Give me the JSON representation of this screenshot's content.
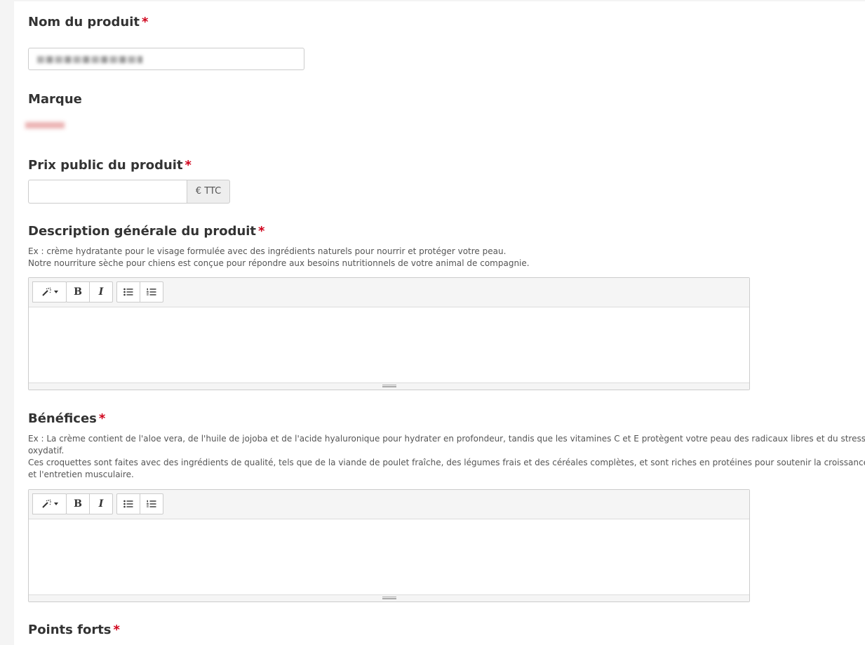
{
  "fields": {
    "product_name": {
      "label": "Nom du produit",
      "required_mark": "*"
    },
    "brand": {
      "label": "Marque"
    },
    "price": {
      "label": "Prix public du produit",
      "required_mark": "*",
      "addon": "€ TTC"
    },
    "description": {
      "label": "Description générale du produit",
      "required_mark": "*",
      "hint_lines": [
        "Ex : crème hydratante pour le visage formulée avec des ingrédients naturels pour nourrir et protéger votre peau.",
        "Notre nourriture sèche pour chiens est conçue pour répondre aux besoins nutritionnels de votre animal de compagnie."
      ]
    },
    "benefits": {
      "label": "Bénéfices",
      "required_mark": "*",
      "hint_lines": [
        "Ex : La crème contient de l'aloe vera, de l'huile de jojoba et de l'acide hyaluronique pour hydrater en profondeur, tandis que les vitamines C et E protègent votre peau des radicaux libres et du stress oxydatif.",
        "Ces croquettes sont faites avec des ingrédients de qualité, tels que de la viande de poulet fraîche, des légumes frais et des céréales complètes, et sont riches en protéines pour soutenir la croissance et l'entretien musculaire."
      ]
    },
    "strengths": {
      "label": "Points forts",
      "required_mark": "*"
    }
  },
  "editor_toolbar": {
    "bold_label": "B",
    "italic_label": "I",
    "icons": [
      "magic-wand-icon",
      "bullet-list-icon",
      "numbered-list-icon"
    ]
  },
  "colors": {
    "required": "#d0021b",
    "label": "#333333",
    "border": "#cccccc",
    "toolbar_bg": "#f5f5f5",
    "addon_bg": "#eeeeee"
  }
}
